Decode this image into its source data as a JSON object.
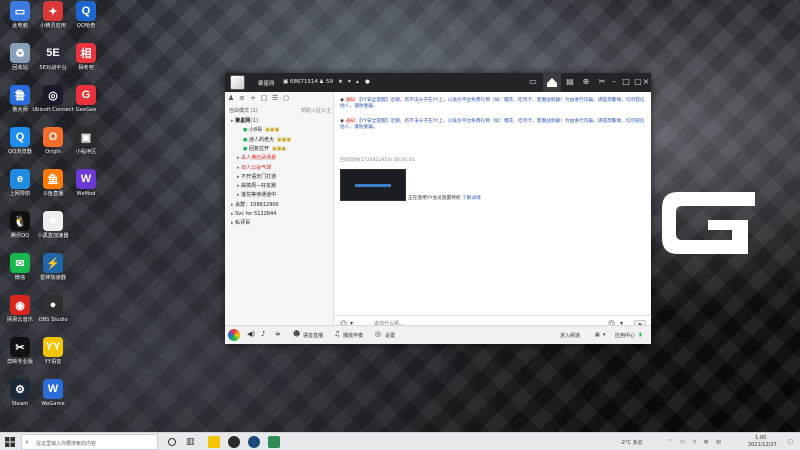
{
  "desktop_icons": [
    {
      "label": "此电脑",
      "icon": "pc-icon",
      "color": "#3b7be0",
      "glyph": "▭",
      "col": 0,
      "row": 0
    },
    {
      "label": "回收站",
      "icon": "recycle-bin-icon",
      "color": "#8aa0b8",
      "glyph": "♻",
      "col": 0,
      "row": 1
    },
    {
      "label": "鲁大师",
      "icon": "ludashi-icon",
      "color": "#2a6de0",
      "glyph": "鲁",
      "col": 0,
      "row": 2
    },
    {
      "label": "QQ浏览器",
      "icon": "qq-browser-icon",
      "color": "#1f8ef1",
      "glyph": "Q",
      "col": 0,
      "row": 3
    },
    {
      "label": "上网导航",
      "icon": "ie-icon",
      "color": "#1e8be0",
      "glyph": "e",
      "col": 0,
      "row": 4
    },
    {
      "label": "腾讯QQ",
      "icon": "qq-icon",
      "color": "#111111",
      "glyph": "🐧",
      "col": 0,
      "row": 5
    },
    {
      "label": "微信",
      "icon": "wechat-icon",
      "color": "#18b84d",
      "glyph": "✉",
      "col": 0,
      "row": 6
    },
    {
      "label": "网易云音乐",
      "icon": "netease-music-icon",
      "color": "#d9261c",
      "glyph": "◉",
      "col": 0,
      "row": 7
    },
    {
      "label": "剪映专业版",
      "icon": "jianying-icon",
      "color": "#111111",
      "glyph": "✂",
      "col": 0,
      "row": 8
    },
    {
      "label": "Steam",
      "icon": "steam-icon",
      "color": "#1b2838",
      "glyph": "⚙",
      "col": 0,
      "row": 9
    },
    {
      "label": "小精灵应用",
      "icon": "sprite-icon",
      "color": "#d93838",
      "glyph": "✦",
      "col": 1,
      "row": 0
    },
    {
      "label": "5E对战平台",
      "icon": "5e-icon",
      "color": "#2c2c3a",
      "glyph": "5E",
      "col": 1,
      "row": 1
    },
    {
      "label": "Ubisoft Connect",
      "icon": "ubisoft-icon",
      "color": "#1a1a2a",
      "glyph": "◎",
      "col": 1,
      "row": 2
    },
    {
      "label": "Origin",
      "icon": "origin-icon",
      "color": "#f56c2d",
      "glyph": "O",
      "col": 1,
      "row": 3
    },
    {
      "label": "斗鱼直播",
      "icon": "douyu-icon",
      "color": "#ff7a00",
      "glyph": "鱼",
      "col": 1,
      "row": 4
    },
    {
      "label": "小黑盒加速器",
      "icon": "heybox-icon",
      "color": "#eeeeee",
      "glyph": "■",
      "col": 1,
      "row": 5
    },
    {
      "label": "雷神加速器",
      "icon": "leishen-icon",
      "color": "#2266aa",
      "glyph": "⚡",
      "col": 1,
      "row": 6
    },
    {
      "label": "OBS Studio",
      "icon": "obs-icon",
      "color": "#302e31",
      "glyph": "●",
      "col": 1,
      "row": 7
    },
    {
      "label": "YY语音",
      "icon": "yy-icon",
      "color": "#f5c400",
      "glyph": "YY",
      "col": 1,
      "row": 8
    },
    {
      "label": "WeGame",
      "icon": "wegame-icon",
      "color": "#2a6dd9",
      "glyph": "W",
      "col": 1,
      "row": 9
    },
    {
      "label": "QQ哈奇",
      "icon": "qq-haqi-icon",
      "color": "#1c66d0",
      "glyph": "Q",
      "col": 2,
      "row": 0
    },
    {
      "label": "相考吧",
      "icon": "xiangkao-icon",
      "color": "#e8323c",
      "glyph": "相",
      "col": 2,
      "row": 1
    },
    {
      "label": "GeeGee",
      "icon": "geegee-icon",
      "color": "#e8323c",
      "glyph": "G",
      "col": 2,
      "row": 2
    },
    {
      "label": "小程序区",
      "icon": "miniapp-icon",
      "color": "#2b2b2b",
      "glyph": "▣",
      "col": 2,
      "row": 3
    },
    {
      "label": "WeMod",
      "icon": "wemod-icon",
      "color": "#6b39d6",
      "glyph": "W",
      "col": 2,
      "row": 4
    }
  ],
  "yy_window": {
    "title": {
      "room_name": "聚星网",
      "room_id": "68671514",
      "user_count": "59"
    },
    "sidebar": {
      "mode_label": "自由模式",
      "mode_count": "(1)",
      "right_hint": "帮助入驻公主",
      "rows": [
        {
          "text": "聚星网",
          "count": "(1)",
          "indent": 0,
          "style": "bold"
        },
        {
          "text": "小8哥",
          "indent": 2,
          "style": "user"
        },
        {
          "text": "迷人的老大",
          "indent": 2,
          "style": "user"
        },
        {
          "text": "回复拉开",
          "indent": 2,
          "style": "user"
        },
        {
          "text": "夫人满比武场景",
          "indent": 1,
          "style": "red"
        },
        {
          "text": "双人公会气球",
          "indent": 1,
          "style": "red"
        },
        {
          "text": "不开语天门打游",
          "indent": 1,
          "style": "normal"
        },
        {
          "text": "踩搞周—好友跑",
          "indent": 1,
          "style": "normal"
        },
        {
          "text": "莲花等待通道中",
          "indent": 1,
          "style": "normal"
        },
        {
          "text": "会群：108812900",
          "indent": 0,
          "style": "normal"
        },
        {
          "text": "Svc for 5122844",
          "indent": 0,
          "style": "normal"
        },
        {
          "text": "私评百",
          "indent": 0,
          "style": "normal"
        }
      ]
    },
    "messages": [
      {
        "prefix": "通知:",
        "text": "【YY安全提醒】近期，有不法分子在YY上，以低价平台免费礼物（如：樱花、吃鸡卡、套圈战机群）为由进行诈骗，请提高警惕，切勿轻信他人，谨防受骗。"
      },
      {
        "prefix": "通知:",
        "text": "【YY安全提醒】近期，有不法分子在YY上，以低价平台免费礼物（如：樱花、吃鸡卡、套圈战机群）为由进行诈骗，请提高警惕，切勿轻信他人，谨防受骗。"
      }
    ],
    "chat_sender": "回问问你(1725922954)  00:40:01",
    "install_note": "正在使用YY会员放置特权",
    "install_link": "了解详情",
    "input_placeholder": "说你什么呢...",
    "send_label": "发送",
    "bottom": {
      "host_label": "语音直播",
      "broadcast_label": "播放伴奏",
      "settings_label": "设置",
      "join_label": "进入频道",
      "apps_label": "应用中心"
    }
  },
  "taskbar": {
    "search_placeholder": "在这里输入你要搜索的内容",
    "weather": "-2°C 多云",
    "time": "1:00",
    "date": "2021/12/27",
    "ime": "中"
  },
  "colors": {
    "accent_red": "#d9261c",
    "link_blue": "#2b54b3",
    "titlebar": "#222428"
  }
}
